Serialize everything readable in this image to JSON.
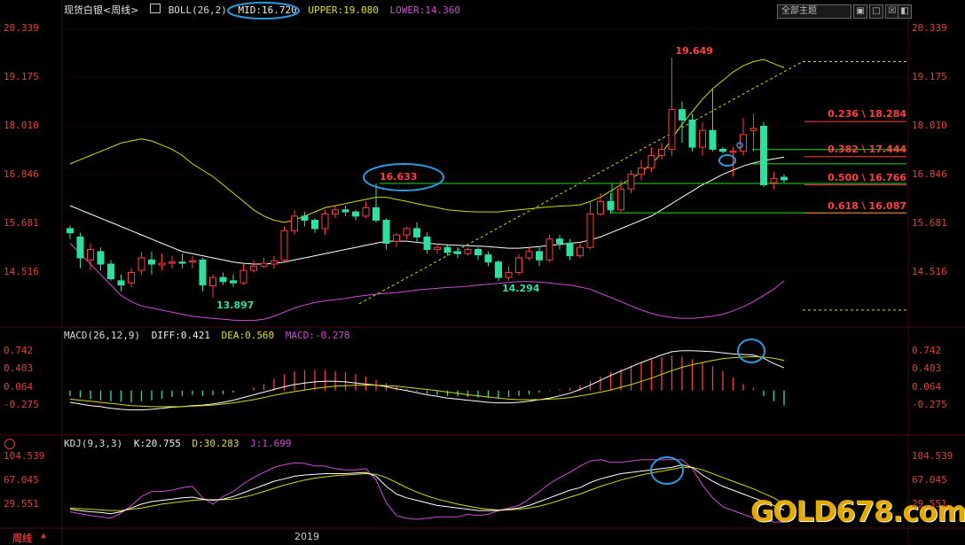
{
  "instrument": "现货白银<周线>",
  "boll": {
    "title": "BOLL(26,2)",
    "mid": "MID:16.720",
    "upper": "UPPER:19.080",
    "lower": "LOWER:14.360"
  },
  "macd": {
    "title": "MACD(26,12,9)",
    "diff": "DIFF:0.421",
    "dea": "DEA:0.560",
    "macd": "MACD:-0.278"
  },
  "kdj": {
    "title": "KDJ(9,3,3)",
    "k": "K:20.755",
    "d": "D:30.283",
    "j": "J:1.699"
  },
  "toolbar": {
    "theme_select": "全部主题",
    "btn1": "▣",
    "btn2": "□",
    "btn3": "☒",
    "btn4": "◧"
  },
  "bottom": {
    "period": "周线",
    "year": "2019"
  },
  "watermark": "GOLD678.com",
  "colors": {
    "up": "#ff3b3b",
    "down": "#2ee0a0",
    "upper": "#d8d800",
    "mid": "#ffffff",
    "lower": "#d04ad8",
    "fib": "#22dd22",
    "annotation": "#2a9be0"
  },
  "chart_data": [
    {
      "type": "candlestick",
      "title": "现货白银<周线>",
      "y_ticks": [
        "20.339",
        "19.175",
        "18.010",
        "16.846",
        "15.681",
        "14.516"
      ],
      "ylim": [
        13.3,
        20.6
      ],
      "candles": [
        [
          15.55,
          15.45,
          15.62,
          15.3
        ],
        [
          15.35,
          14.85,
          15.45,
          14.6
        ],
        [
          14.8,
          15.05,
          15.2,
          14.55
        ],
        [
          15.0,
          14.7,
          15.1,
          14.55
        ],
        [
          14.7,
          14.35,
          14.8,
          14.3
        ],
        [
          14.3,
          14.2,
          14.45,
          14.05
        ],
        [
          14.25,
          14.5,
          14.6,
          14.15
        ],
        [
          14.55,
          14.85,
          15.0,
          14.45
        ],
        [
          14.8,
          14.7,
          15.0,
          14.45
        ],
        [
          14.68,
          14.72,
          14.95,
          14.55
        ],
        [
          14.72,
          14.75,
          14.9,
          14.6
        ],
        [
          14.75,
          14.72,
          14.95,
          14.6
        ],
        [
          14.75,
          14.78,
          14.9,
          14.6
        ],
        [
          14.8,
          14.2,
          14.85,
          14.05
        ],
        [
          14.18,
          14.38,
          14.45,
          13.9
        ],
        [
          14.38,
          14.28,
          14.5,
          14.2
        ],
        [
          14.3,
          14.25,
          14.45,
          14.15
        ],
        [
          14.25,
          14.55,
          14.7,
          14.2
        ],
        [
          14.55,
          14.65,
          14.8,
          14.5
        ],
        [
          14.65,
          14.72,
          14.85,
          14.6
        ],
        [
          14.7,
          14.78,
          14.9,
          14.6
        ],
        [
          14.8,
          15.5,
          15.6,
          14.75
        ],
        [
          15.5,
          15.85,
          16.0,
          15.4
        ],
        [
          15.85,
          15.75,
          15.95,
          15.6
        ],
        [
          15.75,
          15.55,
          15.8,
          15.45
        ],
        [
          15.55,
          15.9,
          16.0,
          15.4
        ],
        [
          15.9,
          16.0,
          16.1,
          15.8
        ],
        [
          16.0,
          15.95,
          16.1,
          15.85
        ],
        [
          15.95,
          15.85,
          16.0,
          15.75
        ],
        [
          15.85,
          16.05,
          16.2,
          15.8
        ],
        [
          16.05,
          15.75,
          16.633,
          15.7
        ],
        [
          15.75,
          15.2,
          15.8,
          15.05
        ],
        [
          15.25,
          15.4,
          15.45,
          15.1
        ],
        [
          15.4,
          15.55,
          15.6,
          15.3
        ],
        [
          15.55,
          15.35,
          15.7,
          15.2
        ],
        [
          15.35,
          15.05,
          15.45,
          14.95
        ],
        [
          15.05,
          15.1,
          15.2,
          14.95
        ],
        [
          15.1,
          14.98,
          15.15,
          14.9
        ],
        [
          15.0,
          14.95,
          15.1,
          14.85
        ],
        [
          14.95,
          15.05,
          15.1,
          14.9
        ],
        [
          15.05,
          14.92,
          15.1,
          14.8
        ],
        [
          14.92,
          14.75,
          15.0,
          14.65
        ],
        [
          14.75,
          14.38,
          14.8,
          14.294
        ],
        [
          14.38,
          14.5,
          14.65,
          14.3
        ],
        [
          14.5,
          14.85,
          14.95,
          14.45
        ],
        [
          14.85,
          15.0,
          15.1,
          14.8
        ],
        [
          15.0,
          14.8,
          15.1,
          14.65
        ],
        [
          14.8,
          15.3,
          15.4,
          14.75
        ],
        [
          15.3,
          15.2,
          15.4,
          15.05
        ],
        [
          15.2,
          14.9,
          15.3,
          14.8
        ],
        [
          14.9,
          15.1,
          15.2,
          14.85
        ],
        [
          15.1,
          15.9,
          16.2,
          15.05
        ],
        [
          15.9,
          16.2,
          16.4,
          15.85
        ],
        [
          16.2,
          16.0,
          16.4,
          15.9
        ],
        [
          16.0,
          16.5,
          16.7,
          15.95
        ],
        [
          16.5,
          16.85,
          16.95,
          16.4
        ],
        [
          16.85,
          17.0,
          17.2,
          16.7
        ],
        [
          17.0,
          17.3,
          17.5,
          16.9
        ],
        [
          17.3,
          17.45,
          17.6,
          17.2
        ],
        [
          17.45,
          18.4,
          19.649,
          17.3
        ],
        [
          18.4,
          18.15,
          18.6,
          17.6
        ],
        [
          18.15,
          17.5,
          18.3,
          17.4
        ],
        [
          17.5,
          17.9,
          18.1,
          17.3
        ],
        [
          17.9,
          17.45,
          18.9,
          17.4
        ],
        [
          17.45,
          17.4,
          17.5,
          17.35
        ],
        [
          17.4,
          17.4,
          17.5,
          16.8
        ],
        [
          17.4,
          17.8,
          18.2,
          17.3
        ],
        [
          17.9,
          17.95,
          18.3,
          17.4
        ],
        [
          18.0,
          16.6,
          18.1,
          16.55
        ],
        [
          16.65,
          16.75,
          16.9,
          16.5
        ],
        [
          16.78,
          16.72,
          16.85,
          16.65
        ]
      ],
      "upper": [
        17.1,
        17.2,
        17.3,
        17.4,
        17.5,
        17.6,
        17.65,
        17.7,
        17.65,
        17.55,
        17.45,
        17.3,
        17.1,
        16.95,
        16.8,
        16.6,
        16.4,
        16.2,
        16.0,
        15.85,
        15.75,
        15.7,
        15.75,
        15.85,
        15.95,
        16.05,
        16.1,
        16.15,
        16.2,
        16.25,
        16.3,
        16.3,
        16.25,
        16.2,
        16.15,
        16.1,
        16.05,
        16.0,
        15.98,
        15.96,
        15.95,
        15.95,
        15.95,
        15.98,
        16.0,
        16.02,
        16.05,
        16.07,
        16.09,
        16.1,
        16.12,
        16.2,
        16.3,
        16.45,
        16.6,
        16.75,
        16.9,
        17.1,
        17.35,
        17.7,
        18.05,
        18.35,
        18.65,
        18.9,
        19.1,
        19.3,
        19.45,
        19.55,
        19.6,
        19.5,
        19.4
      ],
      "mid": [
        16.1,
        16.0,
        15.9,
        15.8,
        15.7,
        15.6,
        15.5,
        15.4,
        15.3,
        15.2,
        15.1,
        15.0,
        14.95,
        14.9,
        14.85,
        14.8,
        14.75,
        14.72,
        14.7,
        14.7,
        14.72,
        14.75,
        14.8,
        14.85,
        14.9,
        14.95,
        15.0,
        15.05,
        15.1,
        15.15,
        15.2,
        15.25,
        15.25,
        15.25,
        15.22,
        15.2,
        15.18,
        15.16,
        15.15,
        15.14,
        15.13,
        15.12,
        15.1,
        15.08,
        15.08,
        15.1,
        15.12,
        15.15,
        15.17,
        15.2,
        15.22,
        15.28,
        15.35,
        15.45,
        15.55,
        15.65,
        15.75,
        15.85,
        16.0,
        16.15,
        16.3,
        16.45,
        16.6,
        16.72,
        16.85,
        16.95,
        17.05,
        17.12,
        17.18,
        17.22,
        17.26
      ],
      "lower": [
        15.2,
        14.95,
        14.7,
        14.45,
        14.2,
        13.95,
        13.8,
        13.7,
        13.65,
        13.6,
        13.55,
        13.5,
        13.45,
        13.42,
        13.4,
        13.38,
        13.36,
        13.35,
        13.35,
        13.38,
        13.45,
        13.55,
        13.65,
        13.72,
        13.78,
        13.82,
        13.85,
        13.88,
        13.92,
        13.95,
        13.98,
        14.0,
        14.02,
        14.05,
        14.08,
        14.1,
        14.12,
        14.14,
        14.15,
        14.17,
        14.2,
        14.22,
        14.24,
        14.26,
        14.28,
        14.28,
        14.27,
        14.25,
        14.22,
        14.2,
        14.15,
        14.1,
        14.0,
        13.9,
        13.8,
        13.7,
        13.6,
        13.52,
        13.46,
        13.42,
        13.4,
        13.4,
        13.42,
        13.45,
        13.5,
        13.58,
        13.68,
        13.8,
        13.95,
        14.1,
        14.3
      ],
      "annotations": [
        {
          "text": "19.649",
          "value": 19.649,
          "candle": 59
        },
        {
          "text": "16.633",
          "value": 16.633,
          "candle": 30
        },
        {
          "text": "13.897",
          "value": 13.897,
          "candle": 14
        },
        {
          "text": "14.294",
          "value": 14.294,
          "candle": 42
        }
      ],
      "fibonacci": [
        {
          "label": "0.236 \\ 18.284",
          "value": 18.284
        },
        {
          "label": "0.382 \\ 17.444",
          "value": 17.444
        },
        {
          "label": "0.500 \\ 16.766",
          "value": 16.766
        },
        {
          "label": "0.618 \\ 16.087",
          "value": 16.087
        }
      ]
    },
    {
      "type": "bar",
      "title": "MACD(26,12,9)",
      "y_ticks": [
        "0.742",
        "0.403",
        "0.064",
        "-0.275"
      ],
      "ylim": [
        -0.45,
        0.9
      ],
      "macd": [
        -0.1,
        -0.13,
        -0.16,
        -0.18,
        -0.2,
        -0.21,
        -0.22,
        -0.2,
        -0.18,
        -0.15,
        -0.12,
        -0.1,
        -0.08,
        -0.1,
        -0.09,
        -0.07,
        -0.04,
        0.0,
        0.06,
        0.12,
        0.22,
        0.3,
        0.36,
        0.38,
        0.38,
        0.38,
        0.36,
        0.34,
        0.3,
        0.26,
        0.2,
        0.14,
        0.08,
        0.03,
        -0.02,
        -0.06,
        -0.08,
        -0.1,
        -0.11,
        -0.12,
        -0.13,
        -0.14,
        -0.14,
        -0.12,
        -0.1,
        -0.07,
        -0.04,
        -0.01,
        0.02,
        0.05,
        0.1,
        0.18,
        0.26,
        0.34,
        0.4,
        0.46,
        0.52,
        0.58,
        0.62,
        0.65,
        0.63,
        0.58,
        0.52,
        0.45,
        0.36,
        0.24,
        0.12,
        0.05,
        -0.1,
        -0.2,
        -0.278
      ],
      "diff": [
        -0.22,
        -0.25,
        -0.28,
        -0.3,
        -0.33,
        -0.35,
        -0.36,
        -0.36,
        -0.35,
        -0.33,
        -0.31,
        -0.3,
        -0.28,
        -0.27,
        -0.25,
        -0.22,
        -0.18,
        -0.13,
        -0.08,
        -0.03,
        0.02,
        0.07,
        0.11,
        0.14,
        0.16,
        0.17,
        0.17,
        0.16,
        0.14,
        0.12,
        0.1,
        0.07,
        0.03,
        0.0,
        -0.04,
        -0.08,
        -0.11,
        -0.14,
        -0.16,
        -0.18,
        -0.2,
        -0.22,
        -0.23,
        -0.23,
        -0.22,
        -0.2,
        -0.17,
        -0.14,
        -0.1,
        -0.05,
        0.02,
        0.1,
        0.19,
        0.28,
        0.36,
        0.44,
        0.52,
        0.59,
        0.66,
        0.72,
        0.74,
        0.74,
        0.73,
        0.72,
        0.7,
        0.68,
        0.67,
        0.66,
        0.6,
        0.5,
        0.421
      ],
      "dea": [
        -0.16,
        -0.18,
        -0.2,
        -0.22,
        -0.24,
        -0.26,
        -0.28,
        -0.29,
        -0.3,
        -0.3,
        -0.3,
        -0.3,
        -0.29,
        -0.28,
        -0.27,
        -0.25,
        -0.23,
        -0.2,
        -0.17,
        -0.13,
        -0.09,
        -0.05,
        -0.02,
        0.01,
        0.04,
        0.06,
        0.08,
        0.09,
        0.1,
        0.1,
        0.1,
        0.09,
        0.08,
        0.06,
        0.04,
        0.02,
        0.0,
        -0.03,
        -0.05,
        -0.08,
        -0.1,
        -0.12,
        -0.14,
        -0.16,
        -0.17,
        -0.17,
        -0.17,
        -0.16,
        -0.15,
        -0.13,
        -0.1,
        -0.07,
        -0.03,
        0.01,
        0.06,
        0.11,
        0.17,
        0.23,
        0.3,
        0.37,
        0.43,
        0.48,
        0.52,
        0.56,
        0.59,
        0.61,
        0.62,
        0.63,
        0.62,
        0.6,
        0.56
      ]
    },
    {
      "type": "line",
      "title": "KDJ(9,3,3)",
      "y_ticks": [
        "104.539",
        "67.045",
        "29.551"
      ],
      "ylim": [
        -5,
        115
      ],
      "k": [
        22,
        20,
        18,
        17,
        15,
        18,
        24,
        30,
        34,
        36,
        38,
        40,
        41,
        38,
        36,
        38,
        42,
        48,
        54,
        60,
        66,
        70,
        74,
        76,
        77,
        78,
        78,
        78,
        79,
        80,
        74,
        58,
        46,
        40,
        36,
        32,
        28,
        26,
        24,
        22,
        20,
        20,
        20,
        22,
        24,
        28,
        34,
        40,
        46,
        52,
        56,
        64,
        70,
        74,
        78,
        80,
        82,
        84,
        86,
        88,
        92,
        88,
        76,
        66,
        58,
        52,
        46,
        40,
        34,
        28,
        20.755
      ],
      "d": [
        24,
        23,
        22,
        21,
        20,
        20,
        22,
        24,
        27,
        30,
        32,
        34,
        36,
        37,
        37,
        37,
        38,
        41,
        45,
        50,
        55,
        60,
        64,
        68,
        71,
        73,
        75,
        76,
        77,
        78,
        77,
        72,
        64,
        56,
        49,
        43,
        38,
        34,
        30,
        27,
        24,
        22,
        21,
        21,
        22,
        24,
        27,
        31,
        36,
        41,
        46,
        52,
        58,
        63,
        68,
        72,
        76,
        79,
        82,
        85,
        88,
        88,
        84,
        78,
        72,
        66,
        60,
        54,
        47,
        40,
        30.283
      ],
      "j": [
        18,
        15,
        12,
        10,
        8,
        16,
        28,
        42,
        50,
        50,
        52,
        56,
        58,
        40,
        30,
        42,
        50,
        62,
        72,
        80,
        88,
        92,
        95,
        94,
        90,
        90,
        86,
        84,
        84,
        86,
        68,
        32,
        12,
        8,
        6,
        8,
        10,
        10,
        10,
        14,
        12,
        14,
        20,
        24,
        28,
        38,
        50,
        62,
        72,
        80,
        90,
        98,
        100,
        96,
        96,
        98,
        100,
        100,
        100,
        100,
        100,
        86,
        60,
        40,
        26,
        20,
        14,
        8,
        4,
        2,
        1.699
      ]
    }
  ]
}
